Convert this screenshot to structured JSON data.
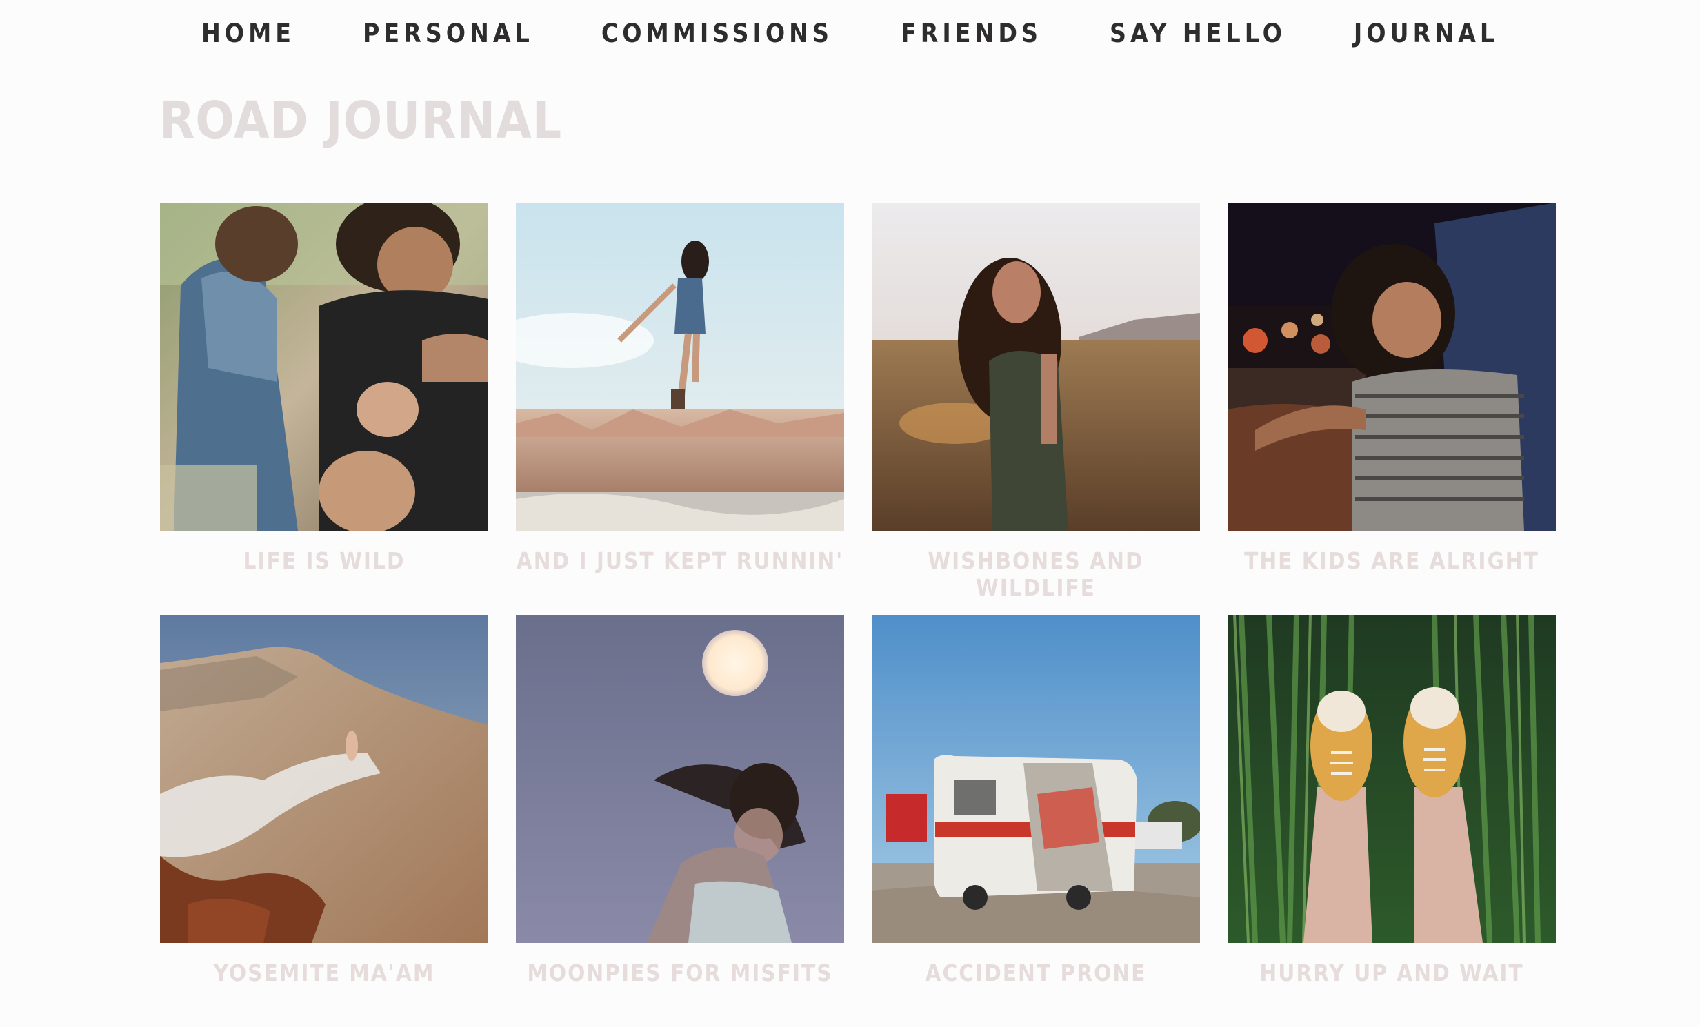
{
  "nav": {
    "items": [
      {
        "label": "HOME"
      },
      {
        "label": "PERSONAL"
      },
      {
        "label": "COMMISSIONS"
      },
      {
        "label": "FRIENDS"
      },
      {
        "label": "SAY HELLO"
      },
      {
        "label": "JOURNAL"
      }
    ]
  },
  "page": {
    "title": "ROAD JOURNAL"
  },
  "posts": [
    {
      "title": "LIFE IS WILD",
      "image": "couple-on-motorcycle-photo"
    },
    {
      "title": "AND I JUST KEPT RUNNIN'",
      "image": "woman-jumping-canyon-photo"
    },
    {
      "title": "WISHBONES AND WILDLIFE",
      "image": "woman-in-field-sunset-photo"
    },
    {
      "title": "THE KIDS ARE ALRIGHT",
      "image": "woman-car-window-night-photo"
    },
    {
      "title": "YOSEMITE MA'AM",
      "image": "person-on-granite-river-photo"
    },
    {
      "title": "MOONPIES FOR MISFITS",
      "image": "woman-under-full-moon-photo"
    },
    {
      "title": "ACCIDENT PRONE",
      "image": "wrecked-trailer-photo"
    },
    {
      "title": "HURRY UP AND WAIT",
      "image": "sneakers-in-grass-photo"
    }
  ],
  "colors": {
    "nav_text": "#2e2c2c",
    "title_text": "#e3dcdc",
    "caption_text": "#e6dcdc",
    "background": "#fcfcfc"
  }
}
